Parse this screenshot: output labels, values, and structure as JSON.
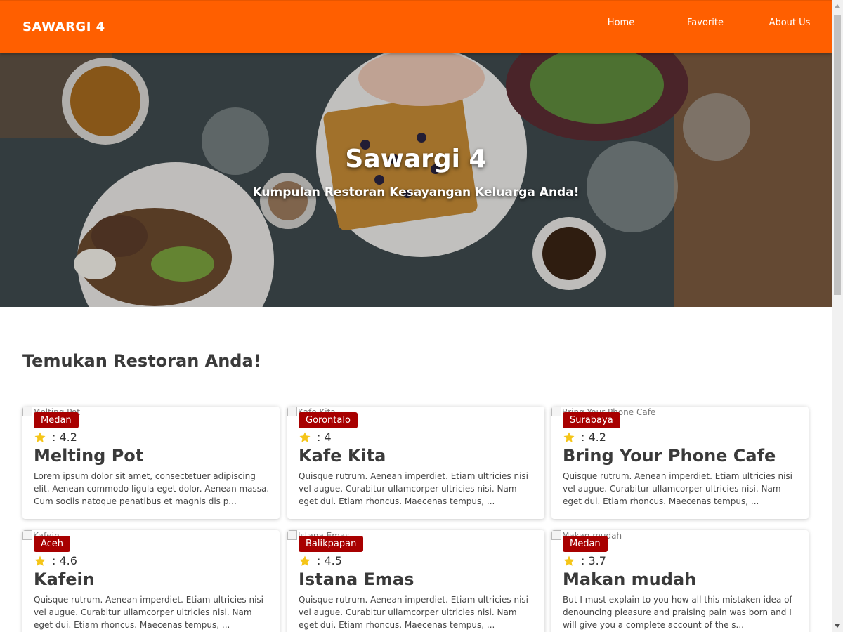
{
  "header": {
    "brand": "SAWARGI 4",
    "nav": [
      {
        "label": "Home"
      },
      {
        "label": "Favorite"
      },
      {
        "label": "About Us"
      }
    ]
  },
  "hero": {
    "title": "Sawargi 4",
    "tagline": "Kumpulan Restoran Kesayangan Keluarga Anda!"
  },
  "section": {
    "heading": "Temukan Restoran Anda!"
  },
  "colors": {
    "header": "#ff5f00",
    "badge": "#a80000",
    "star": "#f5c518"
  },
  "restaurants": [
    {
      "img_alt": "Melting Pot",
      "city": "Medan",
      "rating": ": 4.2",
      "name": "Melting Pot",
      "description": "Lorem ipsum dolor sit amet, consectetuer adipiscing elit. Aenean commodo ligula eget dolor. Aenean massa. Cum sociis natoque penatibus et magnis dis p..."
    },
    {
      "img_alt": "Kafe Kita",
      "city": "Gorontalo",
      "rating": ": 4",
      "name": "Kafe Kita",
      "description": "Quisque rutrum. Aenean imperdiet. Etiam ultricies nisi vel augue. Curabitur ullamcorper ultricies nisi. Nam eget dui. Etiam rhoncus. Maecenas tempus, ..."
    },
    {
      "img_alt": "Bring Your Phone Cafe",
      "city": "Surabaya",
      "rating": ": 4.2",
      "name": "Bring Your Phone Cafe",
      "description": "Quisque rutrum. Aenean imperdiet. Etiam ultricies nisi vel augue. Curabitur ullamcorper ultricies nisi. Nam eget dui. Etiam rhoncus. Maecenas tempus, ..."
    },
    {
      "img_alt": "Kafein",
      "city": "Aceh",
      "rating": ": 4.6",
      "name": "Kafein",
      "description": "Quisque rutrum. Aenean imperdiet. Etiam ultricies nisi vel augue. Curabitur ullamcorper ultricies nisi. Nam eget dui. Etiam rhoncus. Maecenas tempus, ..."
    },
    {
      "img_alt": "Istana Emas",
      "city": "Balikpapan",
      "rating": ": 4.5",
      "name": "Istana Emas",
      "description": "Quisque rutrum. Aenean imperdiet. Etiam ultricies nisi vel augue. Curabitur ullamcorper ultricies nisi. Nam eget dui. Etiam rhoncus. Maecenas tempus, ..."
    },
    {
      "img_alt": "Makan mudah",
      "city": "Medan",
      "rating": ": 3.7",
      "name": "Makan mudah",
      "description": "But I must explain to you how all this mistaken idea of denouncing pleasure and praising pain was born and I will give you a complete account of the s..."
    }
  ]
}
